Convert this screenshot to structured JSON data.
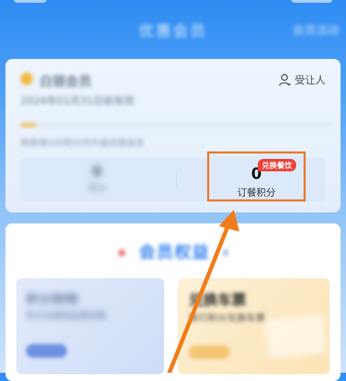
{
  "header": {
    "title": "优惠会员",
    "right_label": "会员活动"
  },
  "member_card": {
    "level_name": "白银会员",
    "assign_label": "受让人",
    "validity_text": "2024年01月31日前有效",
    "progress": 0.05,
    "progress_text": "再获得100积分可升级白银会员",
    "left_points": {
      "value": "0",
      "label": "积分"
    },
    "order_points": {
      "value": "0",
      "label": "订餐积分",
      "badge": "兑换餐饮"
    }
  },
  "benefits": {
    "title": "会员权益",
    "left_tile": {
      "title": "积分购物",
      "subtitle": "积分兑换商品更优惠"
    },
    "right_tile": {
      "title": "兑换车票",
      "subtitle": "铁行积分兑换车票"
    }
  },
  "colors": {
    "accent_blue": "#2f8cf3",
    "highlight_orange": "#e87a2b",
    "badge_red": "#ef3f36"
  },
  "icons": [
    "person-icon",
    "level-coin-icon",
    "annotation-arrow-icon"
  ]
}
